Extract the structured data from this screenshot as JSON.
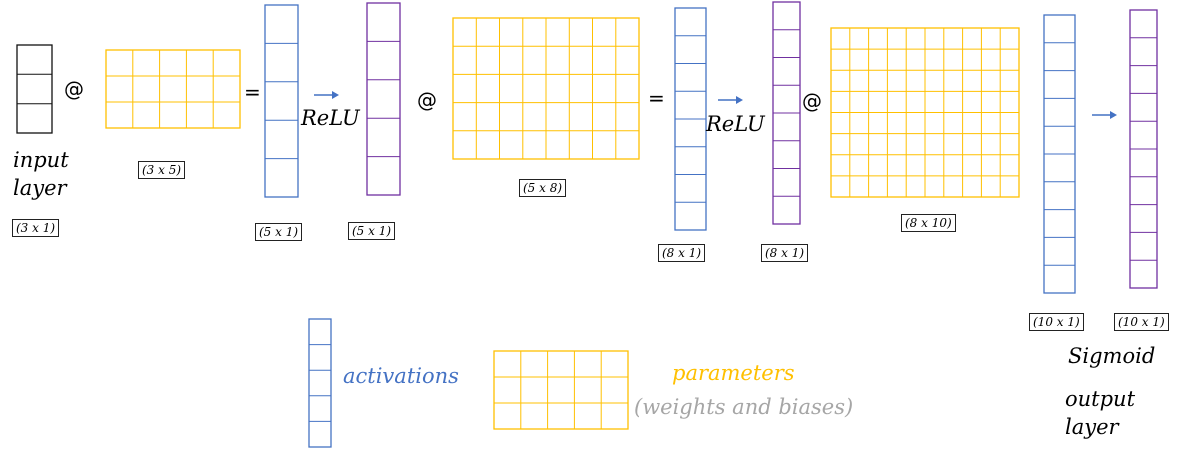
{
  "colors": {
    "input": "#111111",
    "activations": "#4472C4",
    "post_activation": "#7030A0",
    "parameters": "#FFC000",
    "muted": "#A6A6A6"
  },
  "operators": {
    "matmul": "@",
    "equals": "=",
    "relu": "ReLU",
    "sigmoid": "Sigmoid"
  },
  "labels": {
    "input_layer_line1": "input",
    "input_layer_line2": "layer",
    "output_layer_line1": "output",
    "output_layer_line2": "layer"
  },
  "dims": {
    "input": "(3 x 1)",
    "w1": "(3 x 5)",
    "z1": "(5 x 1)",
    "a1": "(5 x 1)",
    "w2": "(5 x 8)",
    "z2": "(8 x 1)",
    "a2": "(8 x 1)",
    "w3": "(8 x 10)",
    "z3": "(10 x 1)",
    "a3": "(10 x 1)"
  },
  "legend": {
    "activations": "activations",
    "parameters": "parameters",
    "parameters_sub": "(weights and biases)"
  },
  "matrices": {
    "input": {
      "rows": 3,
      "cols": 1,
      "color": "input"
    },
    "w1": {
      "rows": 3,
      "cols": 5,
      "color": "parameters"
    },
    "z1": {
      "rows": 5,
      "cols": 1,
      "color": "activations"
    },
    "a1": {
      "rows": 5,
      "cols": 1,
      "color": "post_activation"
    },
    "w2": {
      "rows": 5,
      "cols": 8,
      "color": "parameters"
    },
    "z2": {
      "rows": 8,
      "cols": 1,
      "color": "activations"
    },
    "a2": {
      "rows": 8,
      "cols": 1,
      "color": "post_activation"
    },
    "w3": {
      "rows": 8,
      "cols": 10,
      "color": "parameters"
    },
    "z3": {
      "rows": 10,
      "cols": 1,
      "color": "activations"
    },
    "a3": {
      "rows": 10,
      "cols": 1,
      "color": "post_activation"
    },
    "legend_activation": {
      "rows": 5,
      "cols": 1,
      "color": "activations"
    },
    "legend_parameters": {
      "rows": 3,
      "cols": 5,
      "color": "parameters"
    }
  }
}
